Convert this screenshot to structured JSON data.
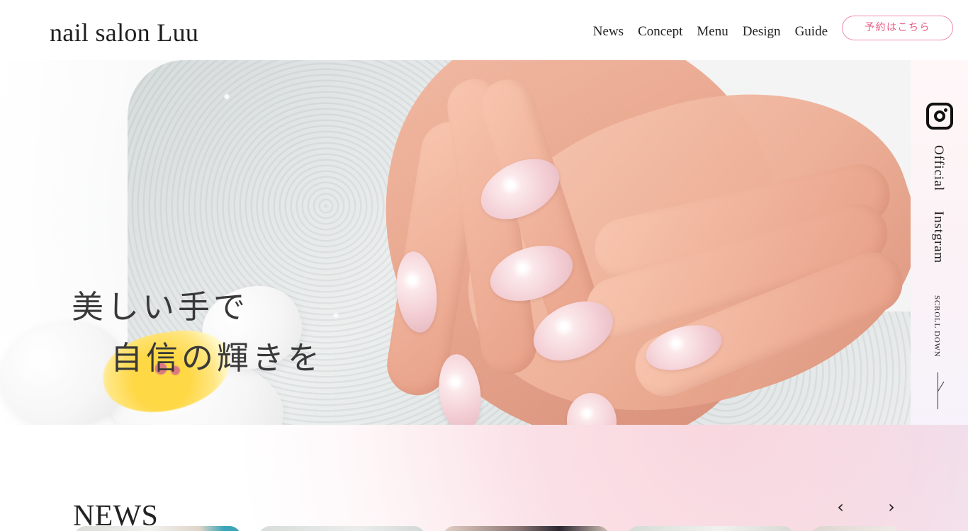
{
  "header": {
    "logo": "nail salon Luu",
    "nav": [
      "News",
      "Concept",
      "Menu",
      "Design",
      "Guide"
    ],
    "reserve_button": "予約はこちら"
  },
  "hero": {
    "headline_line_1": "美しい手で",
    "headline_line_2": "自信の輝きを"
  },
  "side": {
    "official": "Official",
    "instgram": "Instgram",
    "scroll": "SCROLL DOWN",
    "icon": "instagram-icon"
  },
  "news": {
    "title": "NEWS",
    "prev_icon": "chevron-left-icon",
    "next_icon": "chevron-right-icon"
  },
  "colors": {
    "accent_pink": "#e95d87",
    "border_pink": "#ef8ea8",
    "text_dark": "#222222"
  }
}
